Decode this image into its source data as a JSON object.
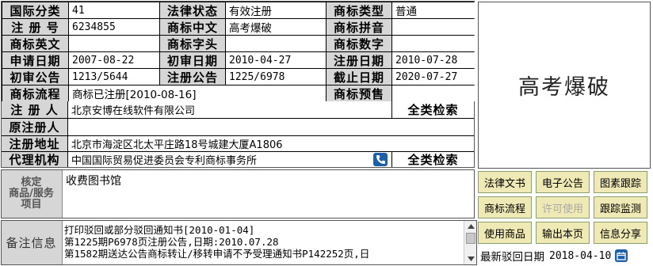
{
  "main_table": {
    "rows": [
      {
        "cells": [
          {
            "label": "国际分类"
          },
          {
            "value": "41"
          },
          {
            "label": "法律状态"
          },
          {
            "value": "有效注册"
          },
          {
            "label": "商标类型"
          },
          {
            "value": "普通"
          }
        ]
      },
      {
        "cells": [
          {
            "label": "注 册 号"
          },
          {
            "value": "6234855"
          },
          {
            "label": "商标中文"
          },
          {
            "value": "高考爆破"
          },
          {
            "label": "商标拼音"
          },
          {
            "value": ""
          }
        ]
      },
      {
        "cells": [
          {
            "label": "商标英文"
          },
          {
            "value": ""
          },
          {
            "label": "商标字头"
          },
          {
            "value": ""
          },
          {
            "label": "商标数字"
          },
          {
            "value": ""
          }
        ]
      },
      {
        "cells": [
          {
            "label": "申请日期"
          },
          {
            "value": "2007-08-22"
          },
          {
            "label": "初审日期"
          },
          {
            "value": "2010-04-27"
          },
          {
            "label": "注册日期"
          },
          {
            "value": "2010-07-28"
          }
        ]
      },
      {
        "cells": [
          {
            "label": "初审公告"
          },
          {
            "value": "1213/5644"
          },
          {
            "label": "注册公告"
          },
          {
            "value": "1225/6978"
          },
          {
            "label": "截止日期"
          },
          {
            "value": "2020-07-27"
          }
        ]
      },
      {
        "cells": [
          {
            "label": "商标流程"
          },
          {
            "value": "商标已注册[2010-08-16]"
          },
          {
            "label": "商标预售"
          },
          {
            "value": ""
          }
        ]
      }
    ],
    "registrant_label": "注 册 人",
    "registrant_value": "北京安博在线软件有限公司",
    "search_all_label": "全类检索",
    "former_label": "原注册人",
    "former_value": "",
    "address_label": "注册地址",
    "address_value": "北京市海淀区北太平庄路18号城建大厦A1806",
    "agency_label": "代理机构",
    "agency_value": "中国国际贸易促进委员会专利商标事务所",
    "search_all_label_2": "全类检索",
    "goods_label_lines": [
      "核定",
      "商品/服务",
      "项目"
    ],
    "goods_value": "收费图书馆",
    "notes_label": "备注信息",
    "notes_lines": [
      "打印驳回或部分驳回通知书[2010-01-04]",
      "第1225期P6978页注册公告,日期:2010.07.28",
      "第1582期送达公告商标转让/移转申请不予受理通知书P142252页,日"
    ]
  },
  "preview": {
    "mark_text": "高考爆破"
  },
  "side_buttons": [
    [
      {
        "label": "法律文书",
        "enabled": true
      },
      {
        "label": "电子公告",
        "enabled": true
      },
      {
        "label": "图素跟踪",
        "enabled": true
      }
    ],
    [
      {
        "label": "商标流程",
        "enabled": true
      },
      {
        "label": "许可使用",
        "enabled": false
      },
      {
        "label": "跟踪监测",
        "enabled": true
      }
    ],
    [
      {
        "label": "使用商品",
        "enabled": true
      },
      {
        "label": "输出本页",
        "enabled": true
      },
      {
        "label": "信息分享",
        "enabled": true
      }
    ]
  ],
  "latest_rejection": {
    "label": "最新驳回日期",
    "date": "2018-04-10"
  },
  "colors": {
    "label_bg": "#d6d6d6",
    "button_bg": "#efe9b6",
    "phone_icon_bg": "#1d5fa8"
  },
  "icons": [
    "phone-icon",
    "calendar-icon",
    "scrollbar-arrow-up-icon",
    "scrollbar-arrow-down-icon"
  ]
}
